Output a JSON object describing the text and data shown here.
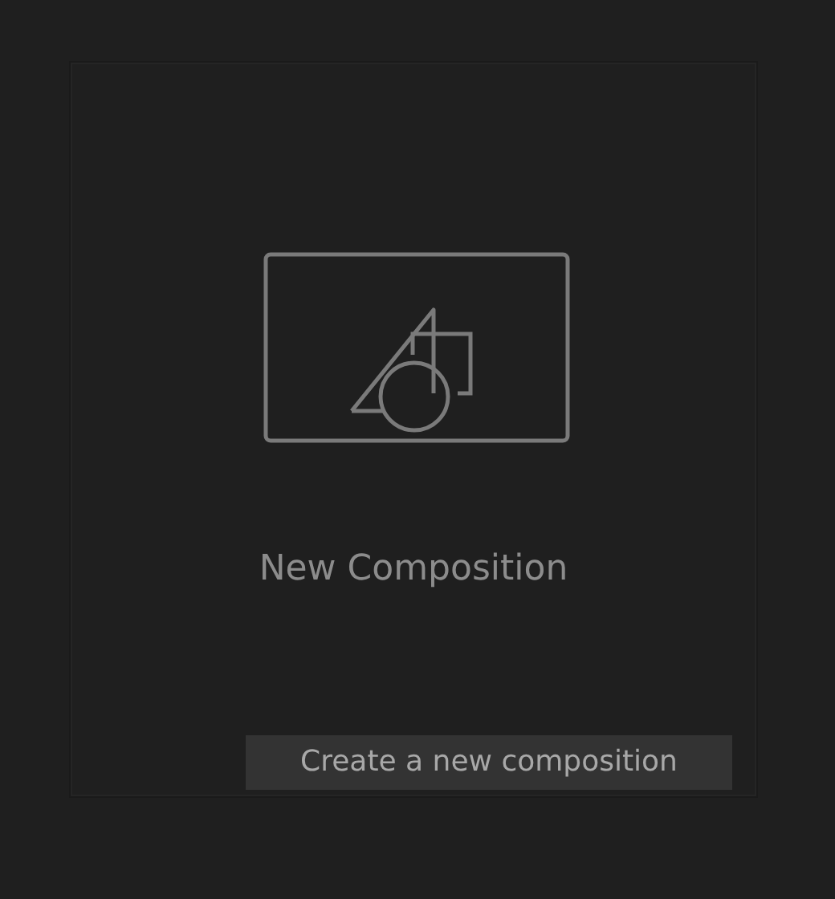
{
  "card": {
    "title": "New Composition"
  },
  "tooltip": {
    "text": "Create a new composition"
  }
}
